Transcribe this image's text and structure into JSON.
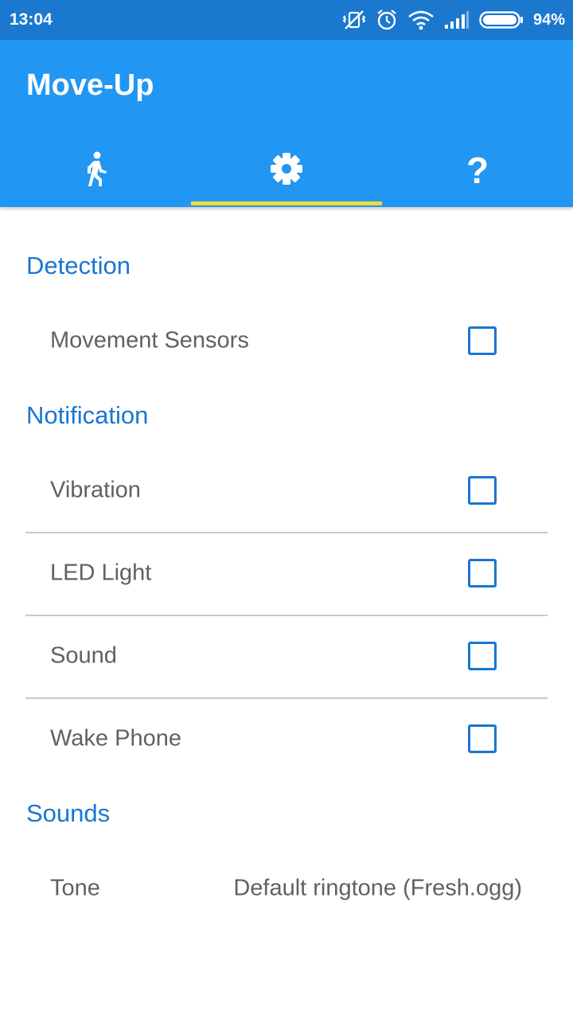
{
  "status_bar": {
    "time": "13:04",
    "battery_percent": "94%",
    "icons": [
      "vibrate-off-icon",
      "alarm-icon",
      "wifi-icon",
      "signal-icon",
      "battery-icon"
    ]
  },
  "app_bar": {
    "title": "Move-Up",
    "tabs": [
      {
        "icon": "walking-person-icon",
        "selected": false
      },
      {
        "icon": "gear-icon",
        "selected": true
      },
      {
        "icon": "help-icon",
        "label": "?",
        "selected": false
      }
    ],
    "colors": {
      "primary": "#2196f3",
      "status_bar": "#1a78cf",
      "indicator": "#fdd835"
    }
  },
  "settings": {
    "sections": [
      {
        "title": "Detection",
        "items": [
          {
            "label": "Movement Sensors",
            "checked": false
          }
        ]
      },
      {
        "title": "Notification",
        "items": [
          {
            "label": "Vibration",
            "checked": false
          },
          {
            "label": "LED Light",
            "checked": false
          },
          {
            "label": "Sound",
            "checked": false
          },
          {
            "label": "Wake Phone",
            "checked": false
          }
        ]
      },
      {
        "title": "Sounds",
        "items": [
          {
            "label": "Tone",
            "value": "Default ringtone (Fresh.ogg)"
          }
        ]
      }
    ],
    "accent_color": "#1976d2"
  }
}
